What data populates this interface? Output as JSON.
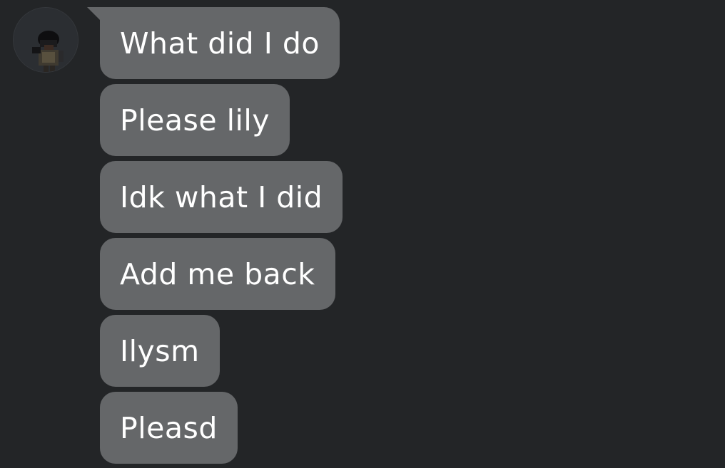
{
  "conversation": {
    "avatar_icon": "roblox-avatar-icon",
    "bubble_color": "#656769",
    "background_color": "#232527",
    "text_color": "#ffffff",
    "messages": [
      {
        "text": "What did I do"
      },
      {
        "text": "Please lily"
      },
      {
        "text": "Idk what I did"
      },
      {
        "text": "Add me back"
      },
      {
        "text": "Ilysm"
      },
      {
        "text": "Pleasd"
      }
    ]
  }
}
